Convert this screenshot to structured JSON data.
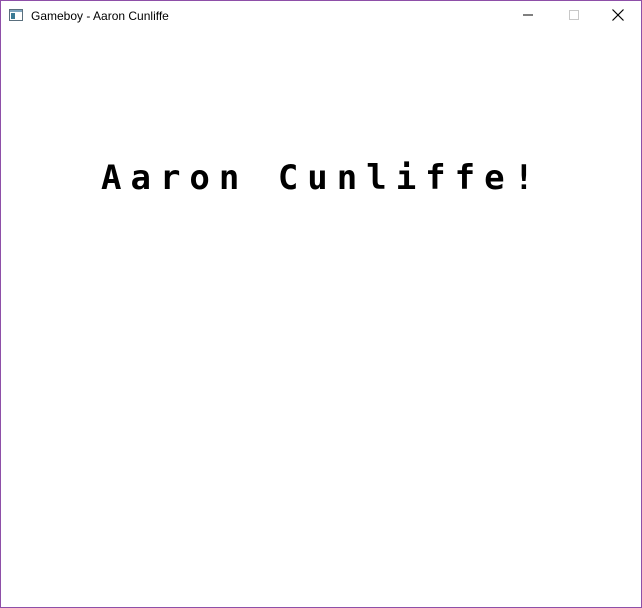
{
  "window": {
    "title": "Gameboy - Aaron Cunliffe",
    "icon": "app-window-icon",
    "controls": {
      "minimize_icon": "minimize-icon",
      "maximize_icon": "maximize-icon",
      "close_icon": "close-icon"
    }
  },
  "screen": {
    "text": "Aaron Cunliffe!"
  },
  "colors": {
    "border": "#8e4fa8",
    "background": "#ffffff",
    "text": "#000000"
  }
}
